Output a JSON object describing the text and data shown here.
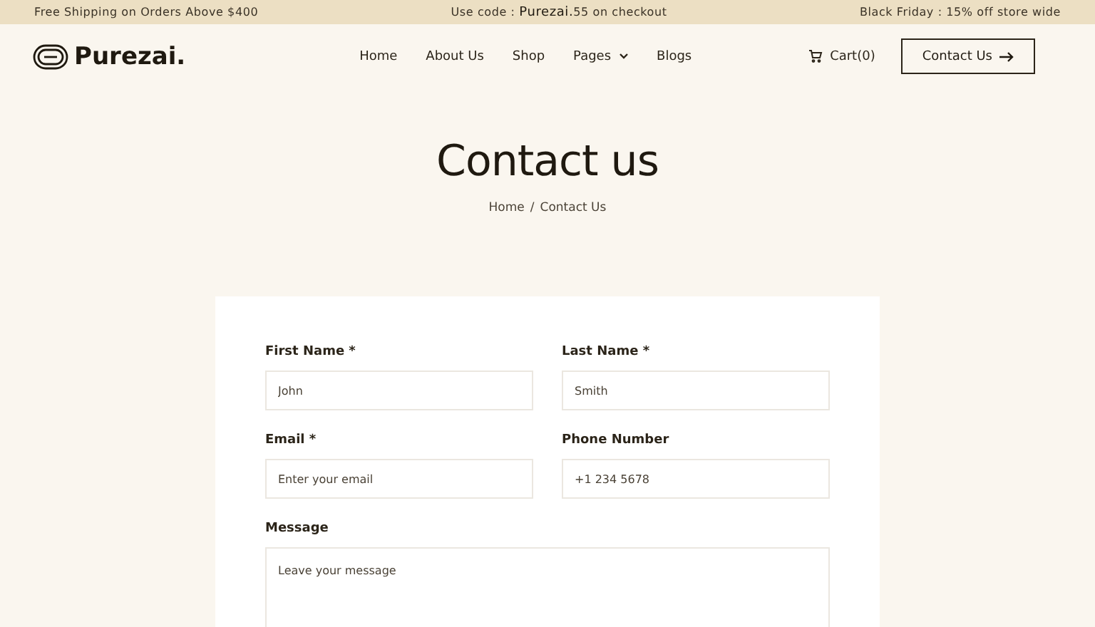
{
  "announcement_bar": [
    "Free Shipping on Orders Above $400",
    "Use code : **Purezai.**55 on checkout",
    "Black Friday : 15% off store wide"
  ],
  "header": {
    "logo": "Purezai.",
    "nav": [
      {
        "label": "Home",
        "dropdown": false
      },
      {
        "label": "About Us",
        "dropdown": false
      },
      {
        "label": "Shop",
        "dropdown": false
      },
      {
        "label": "Pages",
        "dropdown": true
      },
      {
        "label": "Blogs",
        "dropdown": false
      }
    ],
    "cart": "Cart(0)",
    "cta": "Contact Us"
  },
  "hero": {
    "title": "Contact us",
    "breadcrumb": {
      "items": [
        "Home",
        "Contact Us"
      ],
      "separator": "/"
    }
  },
  "form": {
    "fields": [
      {
        "label": "First Name *",
        "placeholder": "John",
        "kind": "input"
      },
      {
        "label": "Last Name *",
        "placeholder": "Smith",
        "kind": "input"
      },
      {
        "label": "Email *",
        "placeholder": "Enter your email",
        "kind": "input"
      },
      {
        "label": "Phone Number",
        "placeholder": "+1 234 5678",
        "kind": "input"
      },
      {
        "label": "Message",
        "placeholder": "Leave your message",
        "kind": "textarea"
      }
    ]
  }
}
